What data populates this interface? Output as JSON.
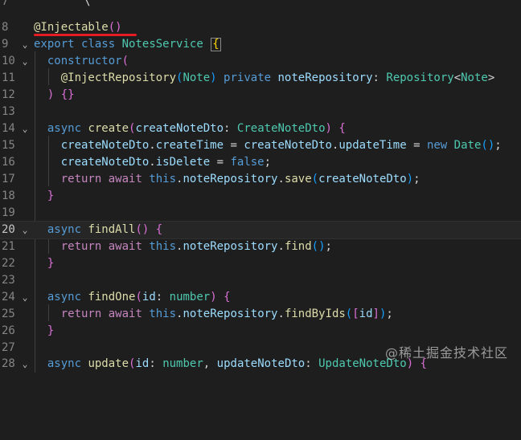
{
  "watermark": "@稀土掘金技术社区",
  "lines": [
    {
      "n": "7",
      "fold": false
    },
    {
      "n": "8",
      "fold": false
    },
    {
      "n": "9",
      "fold": true
    },
    {
      "n": "10",
      "fold": true
    },
    {
      "n": "11",
      "fold": false
    },
    {
      "n": "12",
      "fold": false
    },
    {
      "n": "13",
      "fold": false
    },
    {
      "n": "14",
      "fold": true
    },
    {
      "n": "15",
      "fold": false
    },
    {
      "n": "16",
      "fold": false
    },
    {
      "n": "17",
      "fold": false
    },
    {
      "n": "18",
      "fold": false
    },
    {
      "n": "19",
      "fold": false
    },
    {
      "n": "20",
      "fold": true
    },
    {
      "n": "21",
      "fold": false
    },
    {
      "n": "22",
      "fold": false
    },
    {
      "n": "23",
      "fold": false
    },
    {
      "n": "24",
      "fold": true
    },
    {
      "n": "25",
      "fold": false
    },
    {
      "n": "26",
      "fold": false
    },
    {
      "n": "27",
      "fold": false
    },
    {
      "n": "28",
      "fold": true
    }
  ],
  "tokens": {
    "decorator_injectable": "@Injectable",
    "paren_open": "(",
    "paren_close": ")",
    "export": "export",
    "class": "class",
    "notes_service": "NotesService",
    "brace_open": "{",
    "brace_close": "}",
    "constructor": "constructor",
    "inject_repository": "@InjectRepository",
    "note": "Note",
    "private": "private",
    "note_repository": "noteRepository",
    "colon": ":",
    "repository": "Repository",
    "lt": "<",
    "gt": ">",
    "ctor_close": ") {}",
    "async": "async",
    "create": "create",
    "create_note_dto": "createNoteDto",
    "create_note_dto_type": "CreateNoteDto",
    "dot": ".",
    "create_time": "createTime",
    "update_time": "updateTime",
    "eq": " = ",
    "new": "new",
    "date": "Date",
    "semicolon": ";",
    "is_delete": "isDelete",
    "false": "false",
    "return": "return",
    "await": "await",
    "this": "this",
    "save": "save",
    "find_all": "findAll",
    "find": "find",
    "find_one": "findOne",
    "id": "id",
    "number": "number",
    "find_by_ids": "findByIds",
    "bracket_open": "[",
    "bracket_close": "]",
    "update": "update",
    "comma": ",",
    "update_note_dto": "updateNoteDto",
    "update_note_dto_type": "UpdateNoteDto",
    "top_fragment": "\\",
    "top_fragment2": "'"
  },
  "colors": {
    "background": "#1e1e1e",
    "keyword": "#569cd6",
    "control_keyword": "#c586c0",
    "class_name": "#4ec9b0",
    "function": "#dcdcaa",
    "variable": "#9cdcfe",
    "highlight_underline": "#e51c23"
  }
}
